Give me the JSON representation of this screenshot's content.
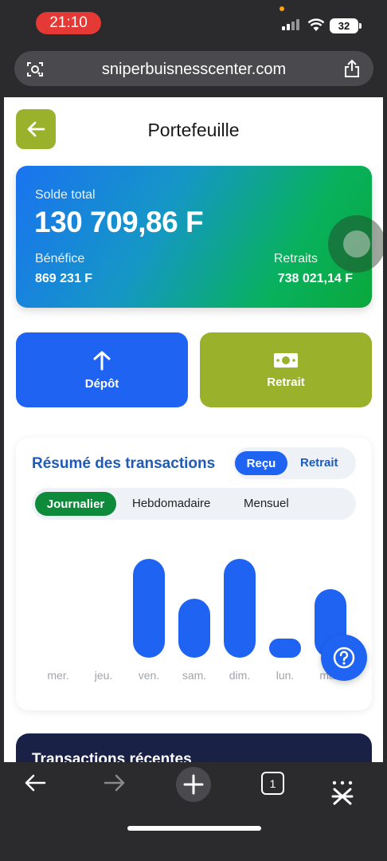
{
  "status_bar": {
    "time": "21:10",
    "battery": "32"
  },
  "browser": {
    "url": "sniperbuisnesscenter.com"
  },
  "page": {
    "title": "Portefeuille"
  },
  "balance": {
    "label": "Solde total",
    "value": "130 709,86 F",
    "profit_label": "Bénéfice",
    "profit_value": "869 231 F",
    "withdrawals_label": "Retraits",
    "withdrawals_value": "738 021,14 F"
  },
  "actions": {
    "deposit_label": "Dépôt",
    "withdraw_label": "Retrait"
  },
  "summary": {
    "title": "Résumé des transactions",
    "type_tabs": [
      "Reçu",
      "Retrait"
    ],
    "period_tabs": [
      "Journalier",
      "Hebdomadaire",
      "Mensuel"
    ]
  },
  "chart_data": {
    "type": "bar",
    "categories": [
      "mer.",
      "jeu.",
      "ven.",
      "sam.",
      "dim.",
      "lun.",
      "mar."
    ],
    "values": [
      0,
      0,
      124,
      74,
      124,
      24,
      86
    ],
    "ylim": [
      0,
      130
    ],
    "grid": false
  },
  "recent": {
    "title": "Transactions récentes"
  },
  "toolbar": {
    "tab_count": "1"
  },
  "colors": {
    "primary": "#1e63f2",
    "olive": "#9ab12c",
    "green": "#0d8a3a",
    "title_blue": "#1e5bb8",
    "navy": "#1a2147"
  }
}
